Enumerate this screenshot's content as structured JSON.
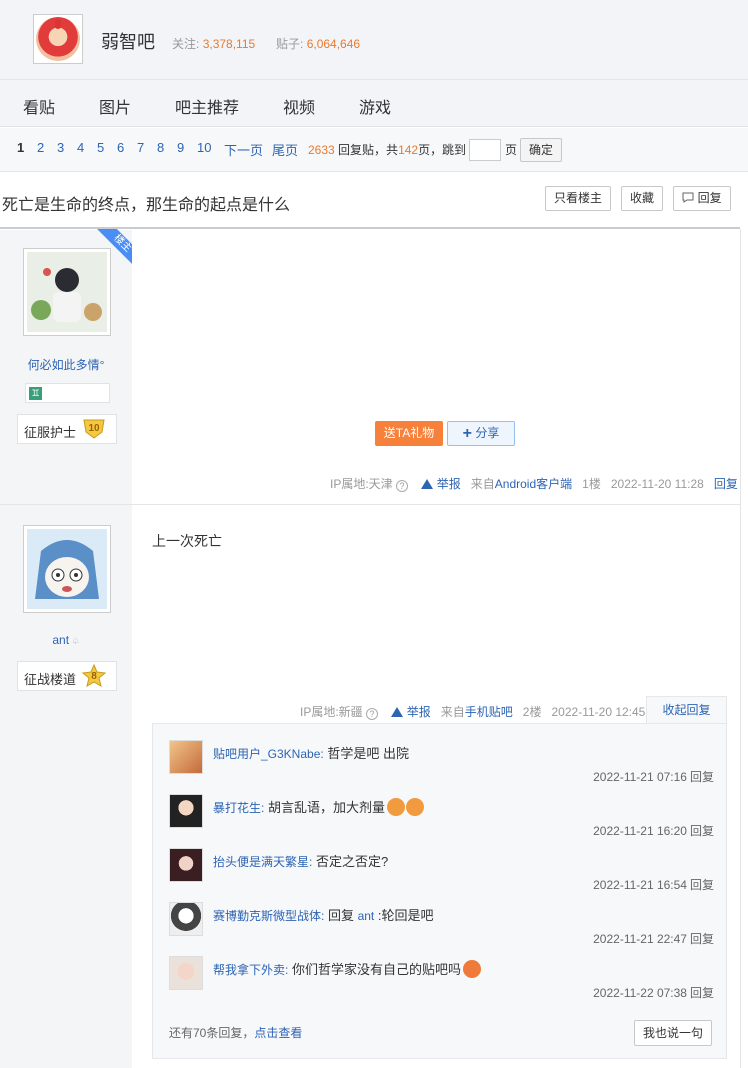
{
  "forum": {
    "name": "弱智吧",
    "follow_label": "关注:",
    "follow_count": "3,378,115",
    "posts_label": "贴子:",
    "posts_count": "6,064,646"
  },
  "nav": [
    "看贴",
    "图片",
    "吧主推荐",
    "视频",
    "游戏"
  ],
  "pager": {
    "pages": [
      "1",
      "2",
      "3",
      "4",
      "5",
      "6",
      "7",
      "8",
      "9",
      "10"
    ],
    "next": "下一页",
    "last": "尾页",
    "reply_count": "2633",
    "reply_label": "回复贴，共",
    "page_total": "142",
    "page_label": "页，",
    "jump_label": "跳到",
    "page_unit": "页",
    "confirm": "确定"
  },
  "thread": {
    "title": "死亡是生命的终点，那生命的起点是什么",
    "only_op": "只看楼主",
    "favorite": "收藏",
    "reply": "回复"
  },
  "post1": {
    "author": "何必如此多情°",
    "op_tag": "楼主",
    "badge_name": "征服护士",
    "badge_level": "10",
    "gift": "送TA礼物",
    "share": "分享",
    "ip": "IP属地:天津",
    "report": "举报",
    "from_prefix": "来自",
    "client": "Android客户端",
    "floor": "1楼",
    "time": "2022-11-20 11:28",
    "reply": "回复"
  },
  "post2": {
    "author": "ant",
    "badge_name": "征战楼道",
    "badge_level": "8",
    "content": "上一次死亡",
    "ip": "IP属地:新疆",
    "report": "举报",
    "from_prefix": "来自",
    "client": "手机贴吧",
    "floor": "2楼",
    "time": "2022-11-20 12:45",
    "collapse": "收起回复"
  },
  "sub_replies": [
    {
      "user": "贴吧用户_G3KNabe:",
      "text": " 哲学是吧 出院",
      "time": "2022-11-21 07:16",
      "reply": "回复"
    },
    {
      "user": "暴打花生:",
      "text": " 胡言乱语，加大剂量",
      "time": "2022-11-21 16:20",
      "reply": "回复"
    },
    {
      "user": "抬头便是满天繁星:",
      "text": " 否定之否定?",
      "time": "2022-11-21 16:54",
      "reply": "回复"
    },
    {
      "user": "赛博勤克斯微型战体:",
      "text": " 回复 ",
      "mention": "ant",
      "text2": " :轮回是吧",
      "time": "2022-11-21 22:47",
      "reply": "回复"
    },
    {
      "user": "帮我拿下外卖:",
      "text": " 你们哲学家没有自己的贴吧吗",
      "time": "2022-11-22 07:38",
      "reply": "回复"
    }
  ],
  "more": {
    "prefix": "还有70条回复，",
    "link": "点击查看",
    "say": "我也说一句"
  },
  "icons": {
    "help": "help-circle-icon",
    "report": "warning-triangle-icon",
    "share": "plus-icon",
    "reply": "speech-bubble-icon"
  },
  "colors": {
    "link": "#2d64b3",
    "accent": "#e97a2e",
    "gift": "#f7813b"
  }
}
